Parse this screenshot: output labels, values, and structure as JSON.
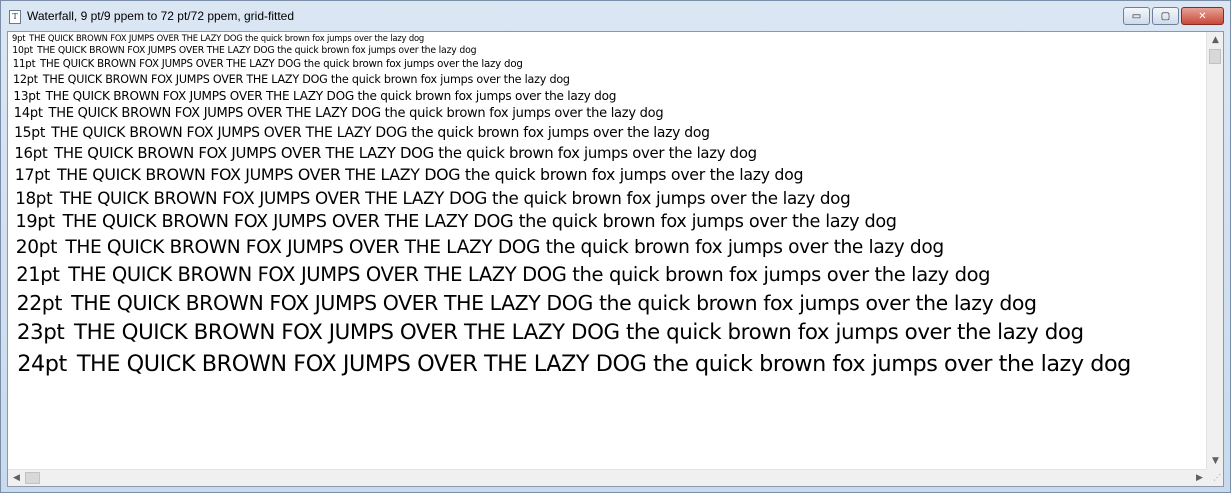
{
  "window": {
    "title": "Waterfall, 9 pt/9 ppem to 72 pt/72 ppem, grid-fitted",
    "app_icon": "document-font-icon",
    "caption_buttons": {
      "minimize": "▭",
      "maximize": "▢",
      "close": "✕"
    }
  },
  "waterfall": {
    "sample_text": "THE QUICK BROWN FOX JUMPS OVER THE LAZY DOG the quick brown fox jumps over the lazy dog",
    "lines": [
      {
        "size_label": "9pt",
        "pt": 9
      },
      {
        "size_label": "10pt",
        "pt": 10
      },
      {
        "size_label": "11pt",
        "pt": 11
      },
      {
        "size_label": "12pt",
        "pt": 12
      },
      {
        "size_label": "13pt",
        "pt": 13
      },
      {
        "size_label": "14pt",
        "pt": 14
      },
      {
        "size_label": "15pt",
        "pt": 15
      },
      {
        "size_label": "16pt",
        "pt": 16
      },
      {
        "size_label": "17pt",
        "pt": 17
      },
      {
        "size_label": "18pt",
        "pt": 18
      },
      {
        "size_label": "19pt",
        "pt": 19
      },
      {
        "size_label": "20pt",
        "pt": 20
      },
      {
        "size_label": "21pt",
        "pt": 21
      },
      {
        "size_label": "22pt",
        "pt": 22
      },
      {
        "size_label": "23pt",
        "pt": 23
      },
      {
        "size_label": "24pt",
        "pt": 24
      }
    ]
  },
  "scrollbars": {
    "up_arrow": "▲",
    "down_arrow": "▼",
    "left_arrow": "◀",
    "right_arrow": "▶",
    "vertical_position": 0,
    "horizontal_position": 0
  }
}
